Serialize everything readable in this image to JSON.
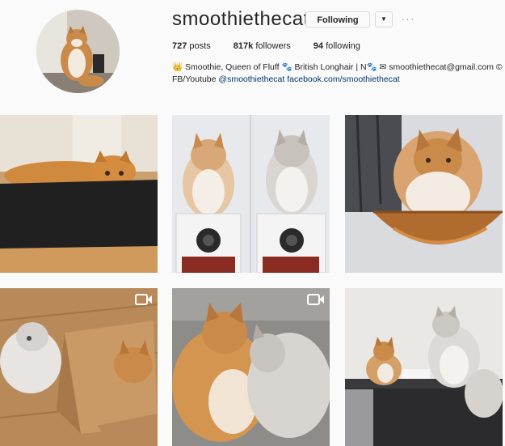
{
  "profile": {
    "username": "smoothiethecat",
    "following_button": "Following",
    "dropdown_glyph": "▼",
    "more_glyph": "···",
    "stats": {
      "posts_value": "727",
      "posts_label": "posts",
      "followers_value": "817k",
      "followers_label": "followers",
      "following_value": "94",
      "following_label": "following"
    },
    "bio": {
      "line1": "👑 Smoothie, Queen of Fluff 🐾 British Longhair | N🐾 ✉ smoothiethecat@gmail.com ©",
      "line2_prefix": "FB/Youtube ",
      "handle_link": "@smoothiethecat",
      "url_link": "facebook.com/smoothiethecat"
    }
  },
  "grid": {
    "posts": [
      {
        "icon": "cat-in-black-box-photo",
        "video": false
      },
      {
        "icon": "two-cats-on-speakers-photo",
        "video": false
      },
      {
        "icon": "cat-in-wooden-bowl-photo",
        "video": false
      },
      {
        "icon": "cats-with-cardboard-box-photo",
        "video": true
      },
      {
        "icon": "two-cats-cuddling-photo",
        "video": true
      },
      {
        "icon": "two-cats-on-sofa-photo",
        "video": false
      }
    ]
  }
}
